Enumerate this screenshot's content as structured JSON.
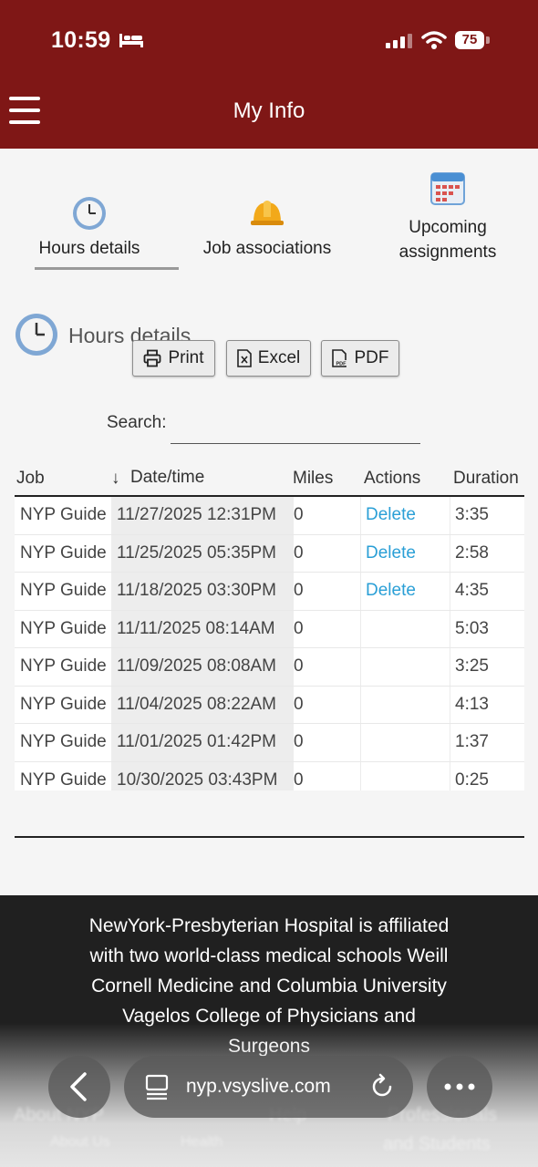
{
  "status_bar": {
    "time": "10:59",
    "battery": "75"
  },
  "header": {
    "title": "My Info"
  },
  "tabs": [
    {
      "label": "Hours details",
      "icon": "clock-icon",
      "active": true
    },
    {
      "label": "Job associations",
      "icon": "hard-hat-icon",
      "active": false
    },
    {
      "label": "Upcoming assignments",
      "icon": "calendar-icon",
      "active": false
    }
  ],
  "section": {
    "title": "Hours details"
  },
  "buttons": {
    "print": "Print",
    "excel": "Excel",
    "pdf": "PDF"
  },
  "search": {
    "label": "Search:",
    "value": "",
    "placeholder": ""
  },
  "table": {
    "headers": {
      "job": "Job",
      "date": "Date/time",
      "miles": "Miles",
      "actions": "Actions",
      "duration": "Duration"
    },
    "sort_indicator": "↓",
    "rows": [
      {
        "job": "NYP Guide",
        "date": "11/27/2025 12:31PM",
        "miles": "0",
        "action": "Delete",
        "duration": "3:35"
      },
      {
        "job": "NYP Guide",
        "date": "11/25/2025 05:35PM",
        "miles": "0",
        "action": "Delete",
        "duration": "2:58"
      },
      {
        "job": "NYP Guide",
        "date": "11/18/2025 03:30PM",
        "miles": "0",
        "action": "Delete",
        "duration": "4:35"
      },
      {
        "job": "NYP Guide",
        "date": "11/11/2025 08:14AM",
        "miles": "0",
        "action": "",
        "duration": "5:03"
      },
      {
        "job": "NYP Guide",
        "date": "11/09/2025 08:08AM",
        "miles": "0",
        "action": "",
        "duration": "3:25"
      },
      {
        "job": "NYP Guide",
        "date": "11/04/2025 08:22AM",
        "miles": "0",
        "action": "",
        "duration": "4:13"
      },
      {
        "job": "NYP Guide",
        "date": "11/01/2025 01:42PM",
        "miles": "0",
        "action": "",
        "duration": "1:37"
      },
      {
        "job": "NYP Guide",
        "date": "10/30/2025 03:43PM",
        "miles": "0",
        "action": "",
        "duration": "0:25"
      }
    ]
  },
  "footer": {
    "text": "NewYork-Presbyterian Hospital is affiliated with two world-class medical schools Weill Cornell Medicine and Columbia University Vagelos College of Physicians and Surgeons",
    "links": [
      "About NYP",
      "About Us",
      "Health",
      "Help",
      "Professionals",
      "and Students"
    ]
  },
  "browser": {
    "url": "nyp.vsyslive.com"
  },
  "colors": {
    "header_bg": "#7f1716",
    "link": "#2a9fd6",
    "footer_bg": "#202020"
  }
}
